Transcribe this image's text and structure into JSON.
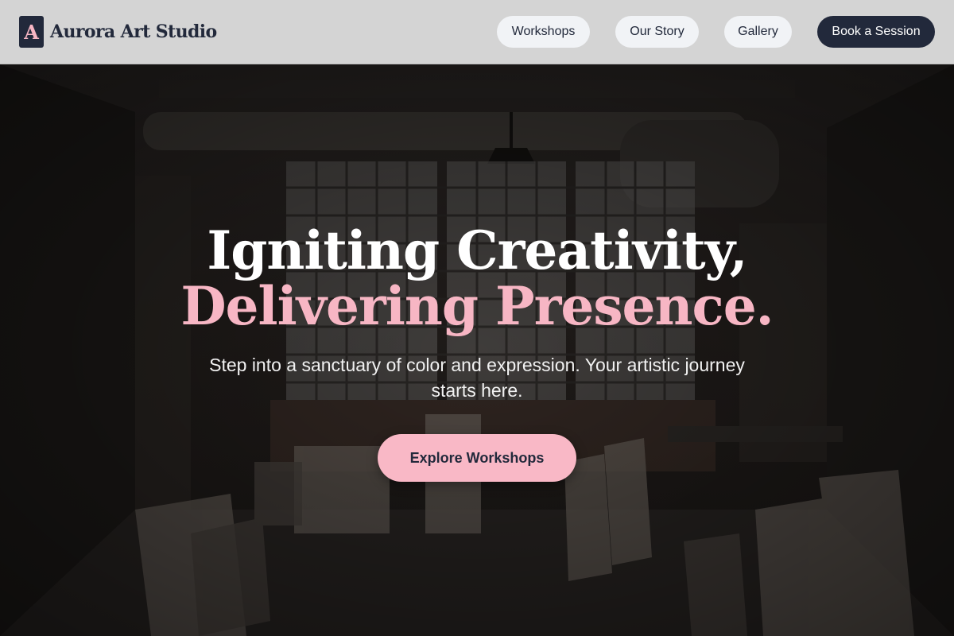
{
  "brand": {
    "logo_letter": "A",
    "name": "Aurora Art Studio"
  },
  "nav": {
    "items": [
      {
        "label": "Workshops"
      },
      {
        "label": "Our Story"
      },
      {
        "label": "Gallery"
      }
    ],
    "cta_label": "Book a Session"
  },
  "hero": {
    "headline_line1": "Igniting Creativity,",
    "headline_line2": "Delivering Presence.",
    "subtext": "Step into a sanctuary of color and expression. Your artistic journey starts here.",
    "button_label": "Explore Workshops"
  },
  "colors": {
    "navy": "#22293b",
    "pink_accent": "#f7b6c4",
    "header_bg": "#d4d4d4",
    "pill_bg": "#f1f3f6"
  },
  "icons": {
    "logo": "letter-a-logo-icon"
  }
}
